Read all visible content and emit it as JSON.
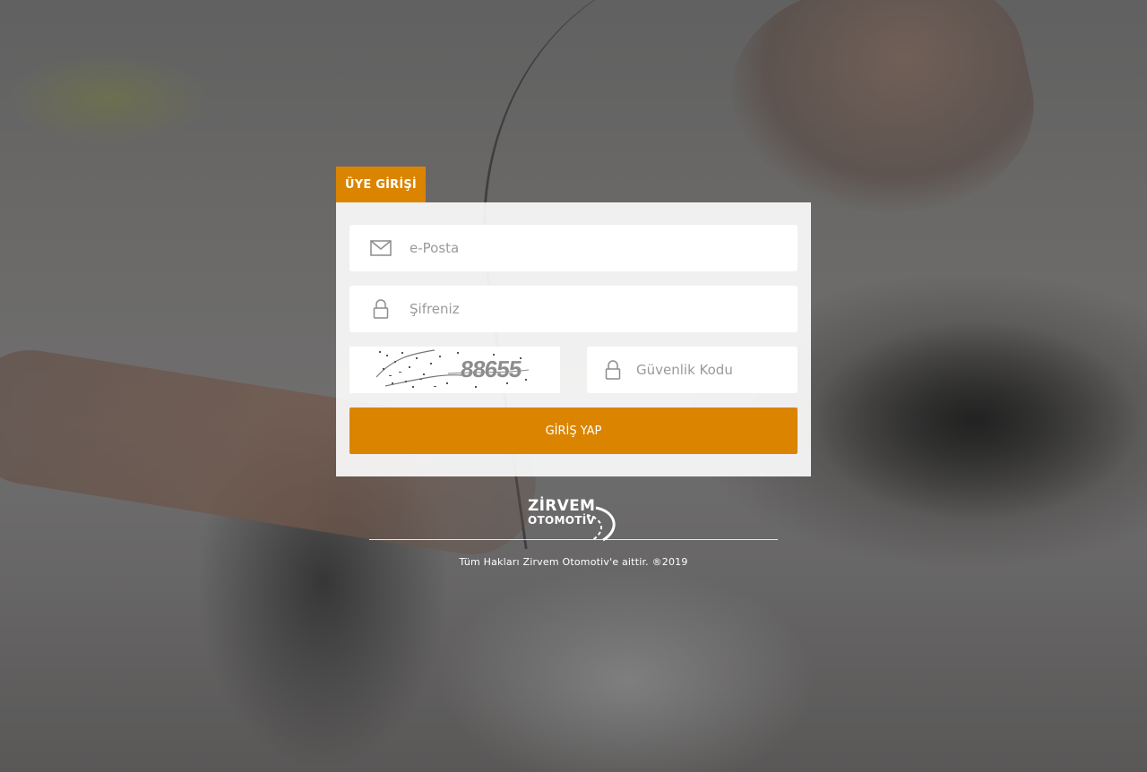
{
  "login": {
    "tab_label": "ÜYE GİRİŞİ",
    "email_placeholder": "e-Posta",
    "password_placeholder": "Şifreniz",
    "captcha_text": "88655",
    "security_code_placeholder": "Güvenlik Kodu",
    "submit_label": "GİRİŞ YAP"
  },
  "brand": {
    "logo_line1": "ZİRVEM",
    "logo_line2": "OTOMOTİV"
  },
  "footer": {
    "copyright": "Tüm Hakları Zirvem Otomotiv'e aittir. ®2019"
  },
  "icons": {
    "email": "envelope-icon",
    "password": "lock-icon",
    "security_code": "lock-icon"
  },
  "colors": {
    "accent": "#db8400",
    "panel": "#ffffff"
  }
}
